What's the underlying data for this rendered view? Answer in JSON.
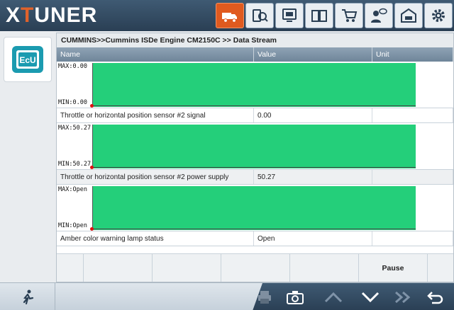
{
  "app": {
    "logo_x": "X",
    "logo_t": "T",
    "logo_rest": "UNER"
  },
  "topbar": {
    "icons": [
      {
        "name": "truck-icon",
        "active": true
      },
      {
        "name": "diagnostic-tools-icon",
        "active": false
      },
      {
        "name": "monitor-icon",
        "active": false
      },
      {
        "name": "manual-book-icon",
        "active": false
      },
      {
        "name": "shopping-cart-icon",
        "active": false
      },
      {
        "name": "support-chat-icon",
        "active": false
      },
      {
        "name": "garage-icon",
        "active": false
      },
      {
        "name": "settings-gear-icon",
        "active": false
      }
    ]
  },
  "sidebar": {
    "ecu_label": "EcU"
  },
  "breadcrumb": "CUMMINS>>Cummins ISDe Engine CM2150C >> Data Stream",
  "table": {
    "headers": {
      "name": "Name",
      "value": "Value",
      "unit": "Unit"
    },
    "rows": [
      {
        "max": "MAX:0.00",
        "min": "MIN:0.00",
        "name": "Throttle or horizontal position sensor #2 signal",
        "value": "0.00",
        "unit": ""
      },
      {
        "max": "MAX:50.27",
        "min": "MIN:50.27",
        "name": "Throttle or horizontal position sensor #2 power supply",
        "value": "50.27",
        "unit": ""
      },
      {
        "max": "MAX:Open",
        "min": "MIN:Open",
        "name": "Amber color warning lamp status",
        "value": "Open",
        "unit": ""
      }
    ]
  },
  "actions": {
    "pause_label": "Pause"
  },
  "bottombar": {
    "icons": [
      "exit-running-man-icon",
      "print-icon",
      "camera-icon",
      "chevron-up-icon",
      "chevron-down-icon",
      "double-chevron-right-icon",
      "back-arrow-icon"
    ]
  },
  "colors": {
    "accent": "#e05a1f",
    "graph_fill": "#24cf7a",
    "header": "#2a3f54"
  }
}
